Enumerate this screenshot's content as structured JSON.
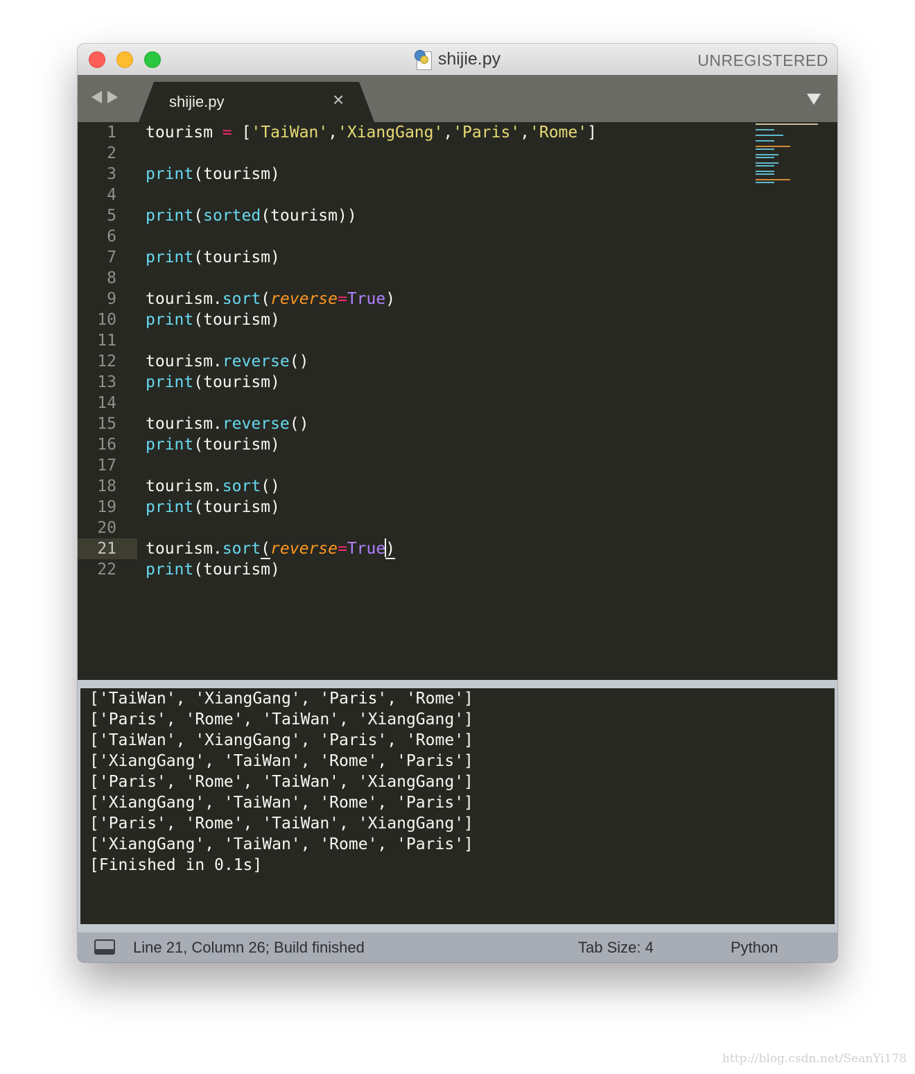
{
  "window": {
    "title": "shijie.py",
    "registration": "UNREGISTERED"
  },
  "tabs": [
    {
      "label": "shijie.py",
      "close": "×"
    }
  ],
  "editor": {
    "line_numbers": [
      "1",
      "2",
      "3",
      "4",
      "5",
      "6",
      "7",
      "8",
      "9",
      "10",
      "11",
      "12",
      "13",
      "14",
      "15",
      "16",
      "17",
      "18",
      "19",
      "20",
      "21",
      "22"
    ],
    "active_line": 21,
    "code": {
      "l1": {
        "var": "tourism",
        "op": "=",
        "open": "[",
        "s1": "'TaiWan'",
        "s2": "'XiangGang'",
        "s3": "'Paris'",
        "s4": "'Rome'",
        "close": "]"
      },
      "l3": {
        "fn": "print",
        "rest": "(tourism)"
      },
      "l5": {
        "fn": "print",
        "open": "(",
        "fn2": "sorted",
        "rest": "(tourism))"
      },
      "l7": {
        "fn": "print",
        "rest": "(tourism)"
      },
      "l9": {
        "var": "tourism.",
        "fn": "sort",
        "open": "(",
        "param": "reverse",
        "op": "=",
        "const": "True",
        "close": ")"
      },
      "l10": {
        "fn": "print",
        "rest": "(tourism)"
      },
      "l12": {
        "var": "tourism.",
        "fn": "reverse",
        "rest": "()"
      },
      "l13": {
        "fn": "print",
        "rest": "(tourism)"
      },
      "l15": {
        "var": "tourism.",
        "fn": "reverse",
        "rest": "()"
      },
      "l16": {
        "fn": "print",
        "rest": "(tourism)"
      },
      "l18": {
        "var": "tourism.",
        "fn": "sort",
        "rest": "()"
      },
      "l19": {
        "fn": "print",
        "rest": "(tourism)"
      },
      "l21": {
        "var": "tourism.",
        "fn": "sort",
        "open": "(",
        "param": "reverse",
        "op": "=",
        "const": "True",
        "close": ")"
      },
      "l22": {
        "fn": "print",
        "rest": "(tourism)"
      }
    }
  },
  "output": {
    "lines": [
      "['TaiWan', 'XiangGang', 'Paris', 'Rome']",
      "['Paris', 'Rome', 'TaiWan', 'XiangGang']",
      "['TaiWan', 'XiangGang', 'Paris', 'Rome']",
      "['XiangGang', 'TaiWan', 'Rome', 'Paris']",
      "['Paris', 'Rome', 'TaiWan', 'XiangGang']",
      "['XiangGang', 'TaiWan', 'Rome', 'Paris']",
      "['Paris', 'Rome', 'TaiWan', 'XiangGang']",
      "['XiangGang', 'TaiWan', 'Rome', 'Paris']",
      "[Finished in 0.1s]"
    ]
  },
  "statusbar": {
    "position": "Line 21, Column 26; Build finished",
    "tab_size": "Tab Size: 4",
    "syntax": "Python"
  },
  "watermark": "http://blog.csdn.net/SeanYi178",
  "colors": {
    "background": "#272822",
    "keyword": "#f92672",
    "string": "#e6db74",
    "function": "#66d9ef",
    "parameter": "#fd971f",
    "constant": "#ae81ff"
  },
  "icons": [
    "close-light",
    "minimize-light",
    "zoom-light",
    "python-file-icon",
    "back-arrow-icon",
    "forward-arrow-icon",
    "tab-close-icon",
    "tab-dropdown-icon",
    "panel-toggle-icon"
  ]
}
